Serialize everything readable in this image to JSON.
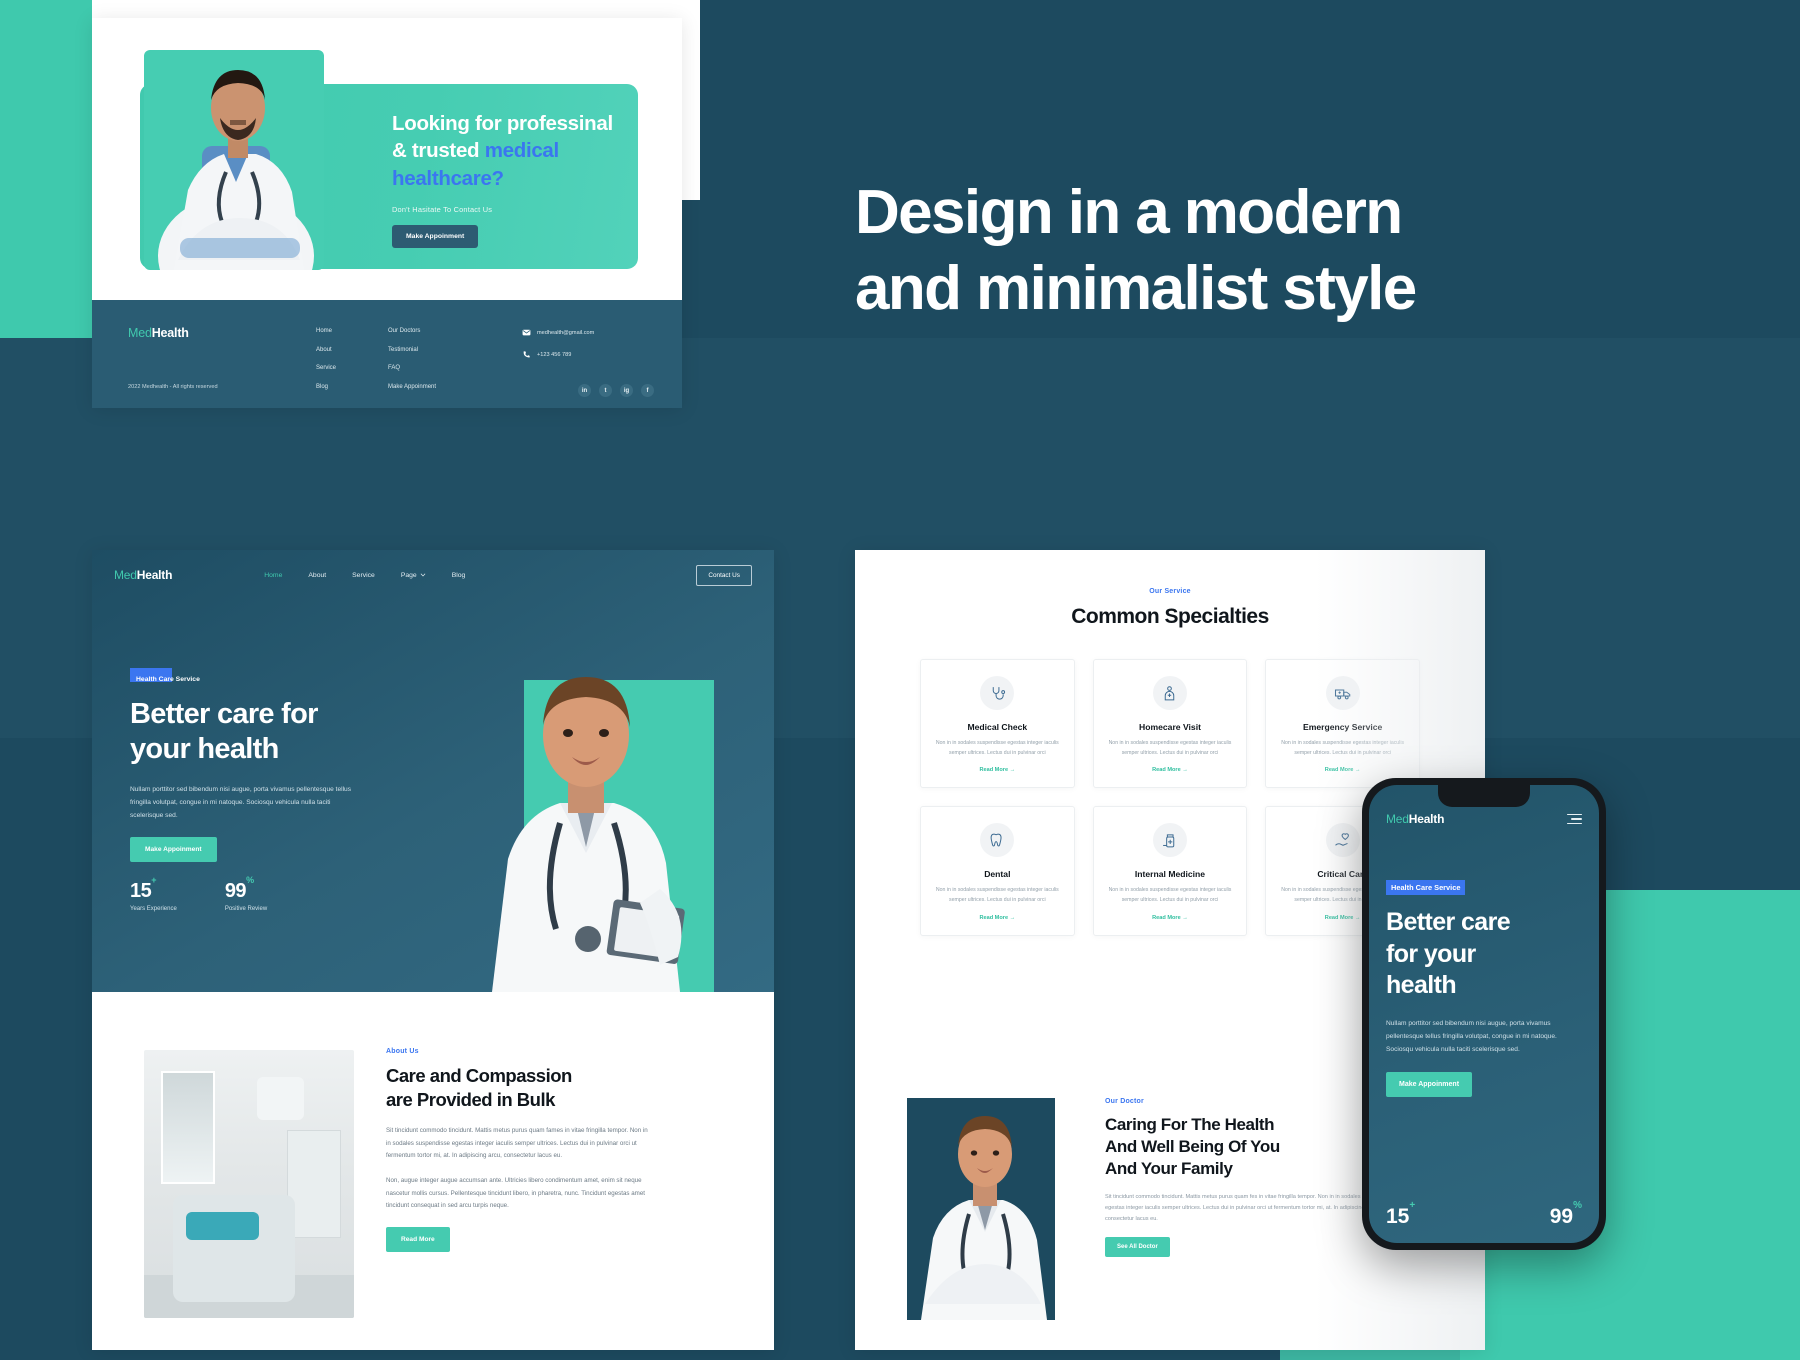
{
  "headline": "Design in a modern\nand minimalist style",
  "brand": {
    "prefix": "Med",
    "suffix": "Health"
  },
  "mockup1": {
    "hero": {
      "title_line1": "Looking for professinal",
      "title_line2_plain": "& trusted ",
      "title_line2_accent": "medical",
      "title_line3_accent": "healthcare?",
      "subtitle": "Don't Hasitate To Contact Us",
      "button": "Make Appoinment"
    },
    "footer": {
      "copyright": "2022 Medhealth - All rights reserved",
      "col1": [
        "Home",
        "About",
        "Service",
        "Blog"
      ],
      "col2": [
        "Our Doctors",
        "Testimonial",
        "FAQ",
        "Make Appoinment"
      ],
      "email": "medhealth@gmail.com",
      "phone": "+123 456 789",
      "social": [
        "in",
        "t",
        "ig",
        "f"
      ]
    }
  },
  "mockup2": {
    "nav": {
      "links": [
        "Home",
        "About",
        "Service",
        "Page",
        "Blog"
      ],
      "active": "Home",
      "dropdown": "Page",
      "cta": "Contact Us"
    },
    "hero": {
      "pill_strong": "Health",
      "pill_rest": " Care Service",
      "title": "Better care for\nyour health",
      "lead": "Nullam porttitor sed bibendum nisi augue, porta vivamus pellentesque tellus fringilla volutpat, congue in mi natoque. Sociosqu vehicula nulla taciti scelerisque sed.",
      "button": "Make Appoinment",
      "stats": [
        {
          "value": "15",
          "sup": "+",
          "label": "Years Experience"
        },
        {
          "value": "99",
          "sup": "%",
          "label": "Positive Review"
        }
      ]
    },
    "about": {
      "eyebrow": "About Us",
      "title": "Care and Compassion\nare Provided in Bulk",
      "p1": "Sit tincidunt commodo tincidunt. Mattis metus purus quam fames in vitae fringilla tempor. Non in in sodales suspendisse egestas integer iaculis semper ultrices. Lectus dui in pulvinar orci ut fermentum tortor mi, at. In adipiscing arcu, consectetur lacus eu.",
      "p2": "Non, augue integer augue accumsan ante. Ultricies libero condimentum amet, enim sit neque nascetur mollis cursus. Pellentesque tincidunt libero, in pharetra, nunc. Tincidunt egestas amet tincidunt consequat in sed arcu turpis neque.",
      "button": "Read More"
    }
  },
  "mockup3": {
    "services": {
      "eyebrow": "Our Service",
      "title": "Common Specialties",
      "card_body": "Non in in sodales suspendisse egestas integer iaculis semper ultrices.  Lectus dui in pulvinar orci",
      "read_more": "Read More  →",
      "cards": [
        {
          "title": "Medical Check",
          "icon": "stethoscope-icon"
        },
        {
          "title": "Homecare Visit",
          "icon": "home-nurse-icon"
        },
        {
          "title": "Emergency Service",
          "icon": "ambulance-icon"
        },
        {
          "title": "Dental",
          "icon": "tooth-icon"
        },
        {
          "title": "Internal Medicine",
          "icon": "medicine-bottle-icon"
        },
        {
          "title": "Critical Care",
          "icon": "hand-heart-icon"
        }
      ]
    },
    "doctor": {
      "eyebrow": "Our Doctor",
      "title": "Caring For The Health\nAnd Well Being Of You\nAnd Your Family",
      "body": "Sit tincidunt commodo tincidunt. Mattis metus purus quam fes in vitae fringilla tempor. Non in in sodales suspendisse egestas integer iaculis semper ultrices. Lectus dui in pulvinar orci ut fermentum tortor mi, at. In adipiscing arcu, consectetur lacus eu.",
      "button": "See All Doctor"
    }
  },
  "phone": {
    "pill_strong": "Health",
    "pill_rest": " Care Service",
    "title": "Better care\nfor your\nhealth",
    "body": "Nullam porttitor sed bibendum nisi augue, porta vivamus pellentesque tellus fringilla volutpat, congue in mi natoque. Sociosqu vehicula nulla taciti scelerisque sed.",
    "button": "Make Appoinment",
    "stats": [
      {
        "value": "15",
        "sup": "+"
      },
      {
        "value": "99",
        "sup": "%"
      }
    ]
  },
  "colors": {
    "teal": "#45cbb0",
    "dark_blue": "#1d4a5f",
    "accent_blue": "#3b76f0",
    "footer_blue": "#2a5c73"
  }
}
